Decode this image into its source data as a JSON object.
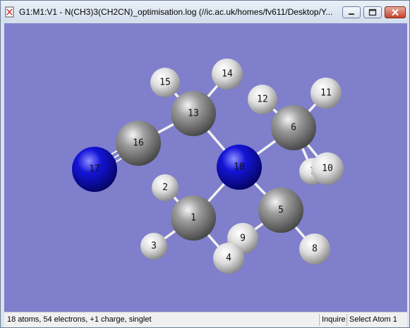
{
  "window": {
    "title": "G1:M1:V1 - N(CH3)3(CH2CN)_optimisation.log (//ic.ac.uk/homes/fv611/Desktop/Y..."
  },
  "title_buttons": {
    "minimize_icon": "minimize-icon",
    "maximize_icon": "maximize-icon",
    "close_icon": "close-icon"
  },
  "viewport": {
    "background_color": "#7f7fcc",
    "atom_colors": {
      "C": "#8a8a8a",
      "H": "#e6e6e6",
      "N": "#1a1ad0"
    },
    "atoms": [
      {
        "id": "1",
        "element": "C"
      },
      {
        "id": "2",
        "element": "H"
      },
      {
        "id": "3",
        "element": "H"
      },
      {
        "id": "4",
        "element": "H"
      },
      {
        "id": "5",
        "element": "C"
      },
      {
        "id": "6",
        "element": "C"
      },
      {
        "id": "7",
        "element": "H"
      },
      {
        "id": "8",
        "element": "H"
      },
      {
        "id": "9",
        "element": "H"
      },
      {
        "id": "10",
        "element": "H"
      },
      {
        "id": "11",
        "element": "H"
      },
      {
        "id": "12",
        "element": "H"
      },
      {
        "id": "13",
        "element": "C"
      },
      {
        "id": "14",
        "element": "H"
      },
      {
        "id": "15",
        "element": "H"
      },
      {
        "id": "16",
        "element": "C"
      },
      {
        "id": "17",
        "element": "N"
      },
      {
        "id": "18",
        "element": "N"
      }
    ]
  },
  "statusbar": {
    "info": "18 atoms, 54 electrons, +1 charge, singlet",
    "mode": "Inquire",
    "selection": "Select Atom 1"
  }
}
